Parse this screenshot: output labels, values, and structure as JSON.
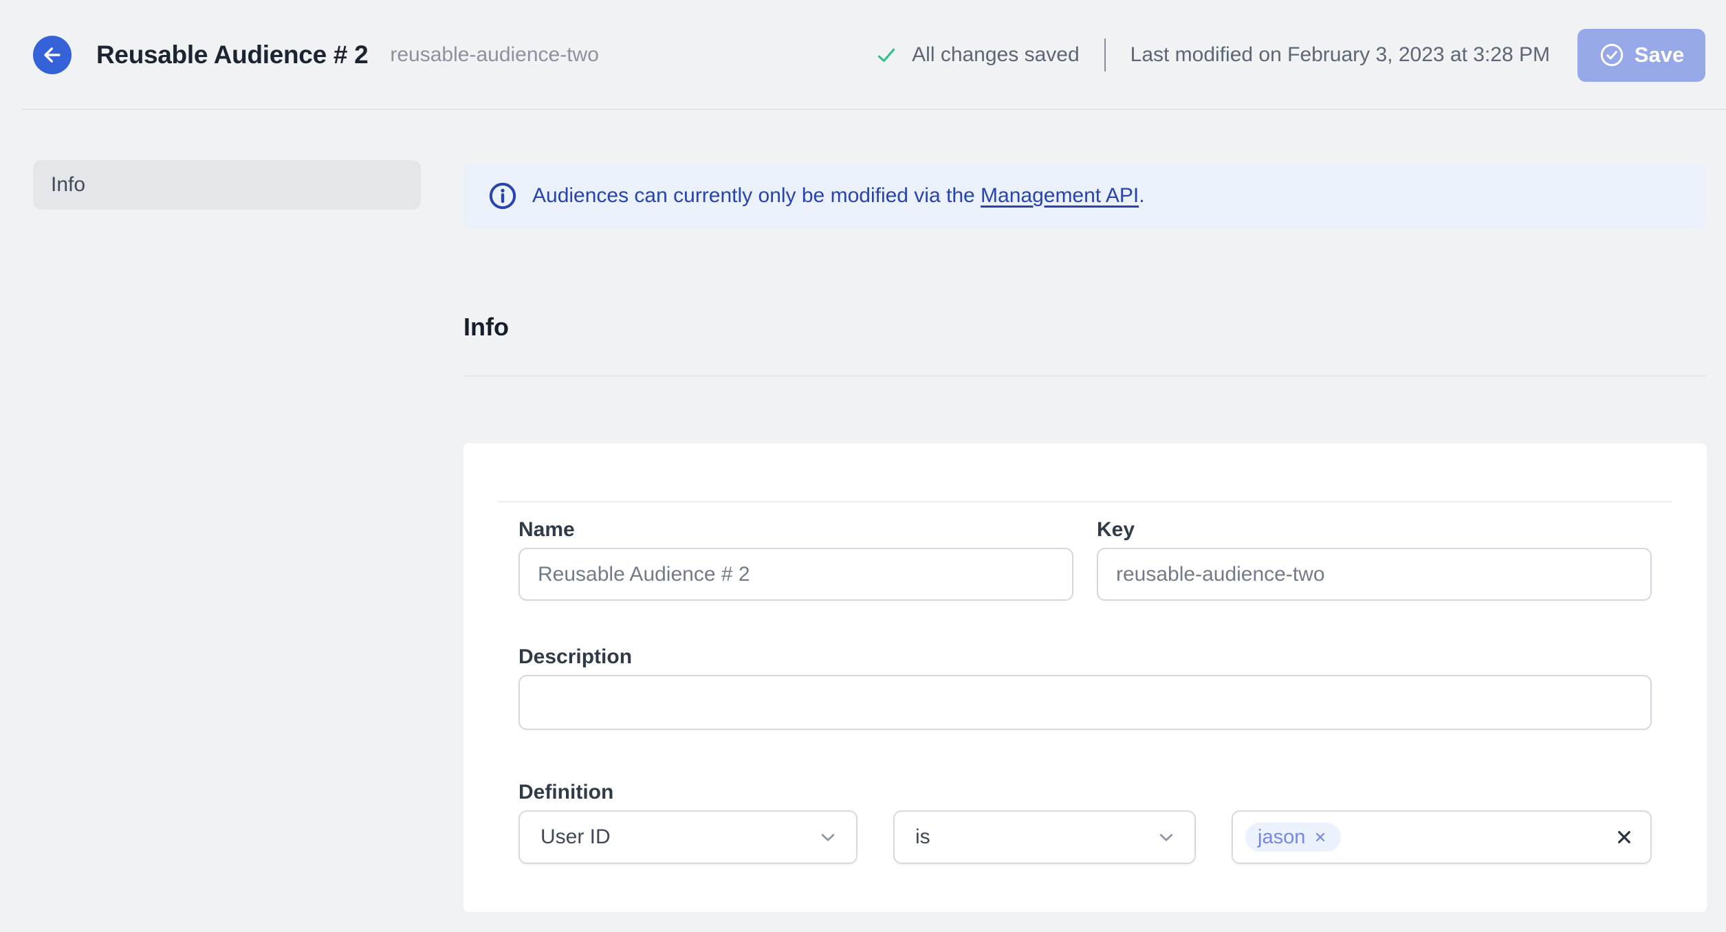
{
  "colors": {
    "accent_blue": "#3562d8",
    "save_button_blue": "#97a8e9",
    "success_green": "#35bd8e",
    "banner_text_blue": "#2843ae",
    "banner_bg": "#eaf1fb",
    "chip_blue": "#7787e8",
    "page_bg": "#f1f2f4"
  },
  "header": {
    "title": "Reusable Audience # 2",
    "slug": "reusable-audience-two",
    "status_text": "All changes saved",
    "last_modified": "Last modified on February 3, 2023 at 3:28 PM",
    "save_label": "Save"
  },
  "sidebar": {
    "items": [
      {
        "label": "Info",
        "active": true
      }
    ]
  },
  "banner": {
    "text": "Audiences can currently only be modified via the ",
    "link_text": "Management API",
    "suffix": "."
  },
  "section": {
    "title": "Info"
  },
  "form": {
    "name": {
      "label": "Name",
      "value": "Reusable Audience # 2"
    },
    "key": {
      "label": "Key",
      "value": "reusable-audience-two"
    },
    "description": {
      "label": "Description",
      "value": ""
    },
    "definition": {
      "label": "Definition",
      "property_selected": "User ID",
      "operator_selected": "is",
      "tags": [
        "jason"
      ]
    }
  }
}
